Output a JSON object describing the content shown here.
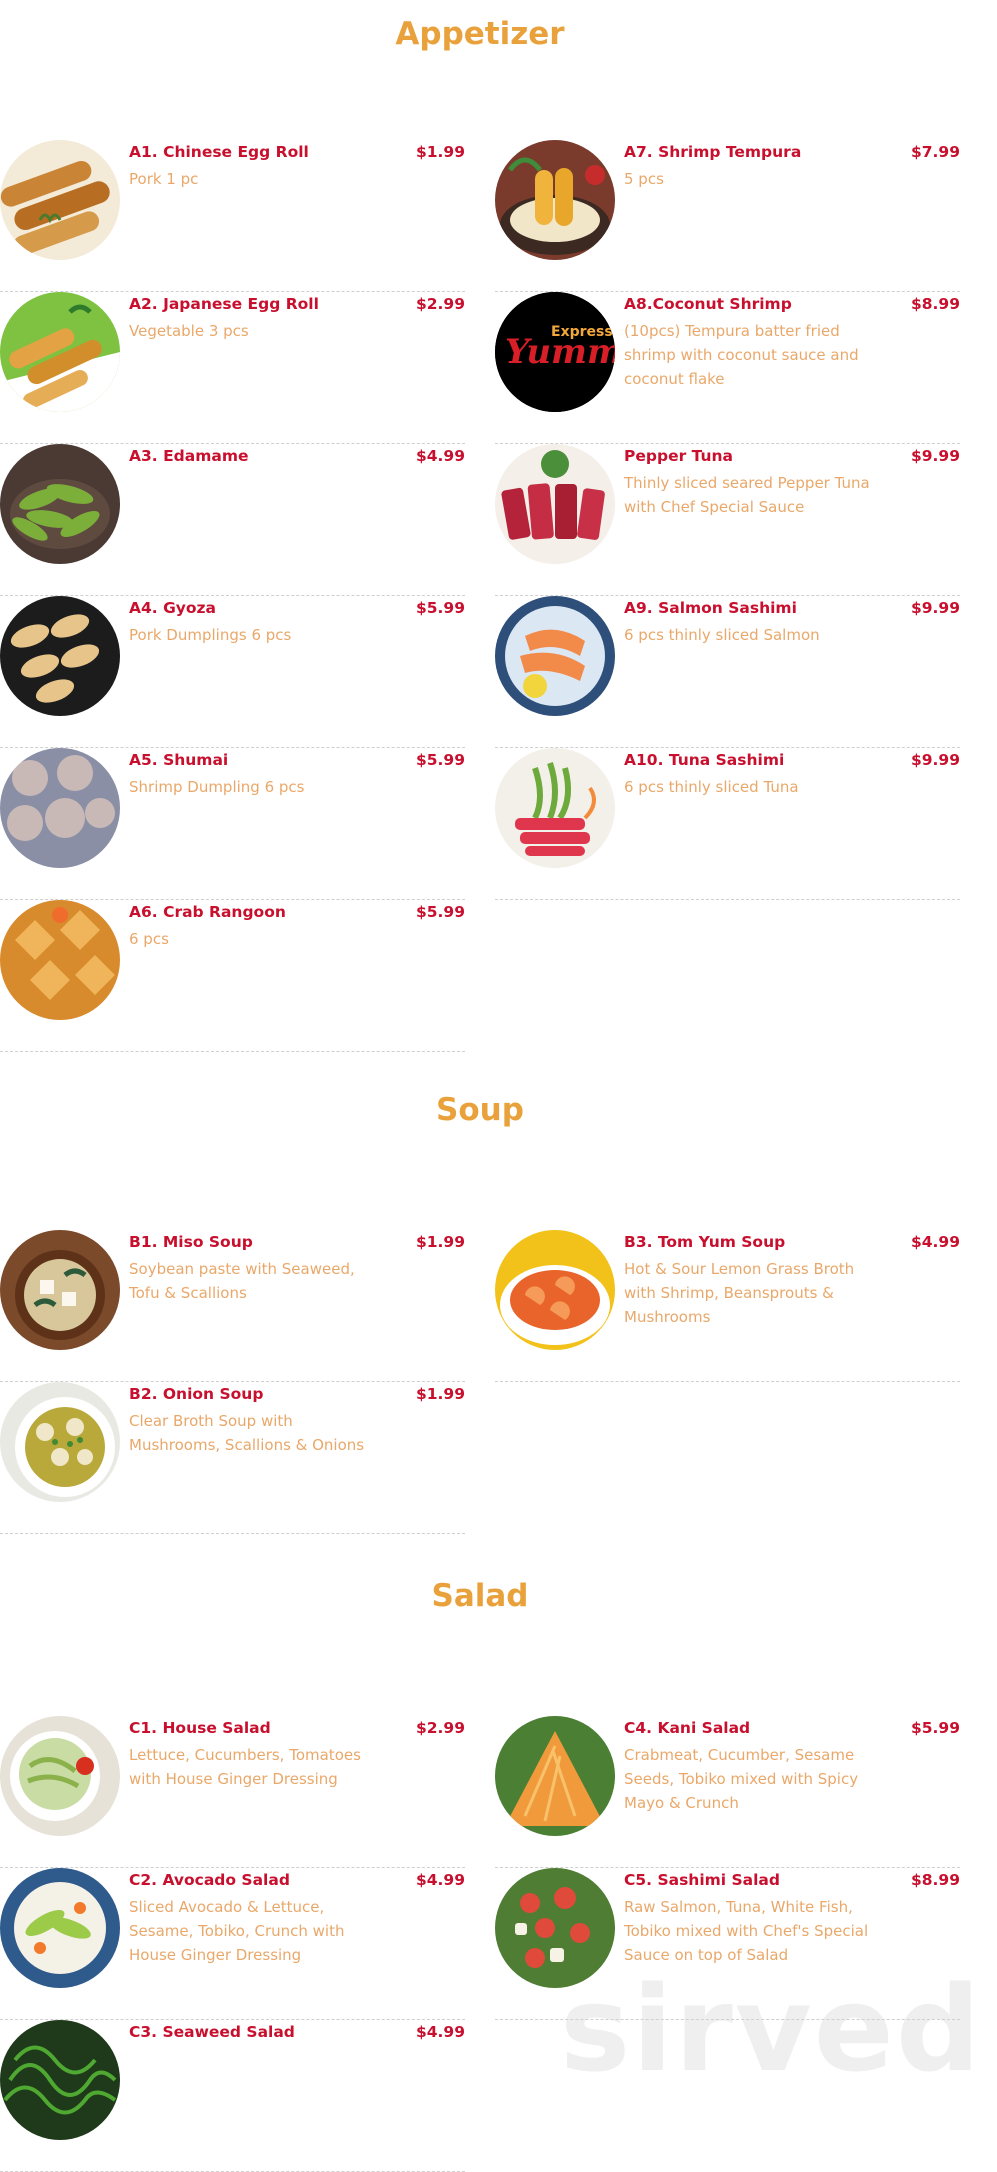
{
  "watermark": "sirved",
  "sections": {
    "appetizer": {
      "title": "Appetizer",
      "items": [
        {
          "name": "A1. Chinese Egg Roll",
          "price": "$1.99",
          "desc": "Pork 1 pc"
        },
        {
          "name": "A7. Shrimp Tempura",
          "price": "$7.99",
          "desc": "5 pcs"
        },
        {
          "name": "A2. Japanese Egg Roll",
          "price": "$2.99",
          "desc": "Vegetable 3 pcs"
        },
        {
          "name": "A8.Coconut Shrimp",
          "price": "$8.99",
          "desc": "(10pcs) Tempura batter fried shrimp with coconut sauce and coconut flake",
          "logo": {
            "top": "Express",
            "script": "Yummy"
          }
        },
        {
          "name": "A3. Edamame",
          "price": "$4.99",
          "desc": ""
        },
        {
          "name": "Pepper Tuna",
          "price": "$9.99",
          "desc": "Thinly sliced seared Pepper Tuna with Chef Special Sauce"
        },
        {
          "name": "A4. Gyoza",
          "price": "$5.99",
          "desc": "Pork Dumplings 6 pcs"
        },
        {
          "name": "A9. Salmon Sashimi",
          "price": "$9.99",
          "desc": "6 pcs thinly sliced Salmon"
        },
        {
          "name": "A5. Shumai",
          "price": "$5.99",
          "desc": "Shrimp Dumpling 6 pcs"
        },
        {
          "name": "A10. Tuna Sashimi",
          "price": "$9.99",
          "desc": "6 pcs thinly sliced Tuna"
        },
        {
          "name": "A6. Crab Rangoon",
          "price": "$5.99",
          "desc": "6 pcs"
        }
      ]
    },
    "soup": {
      "title": "Soup",
      "items": [
        {
          "name": "B1. Miso Soup",
          "price": "$1.99",
          "desc": "Soybean paste with Seaweed, Tofu & Scallions"
        },
        {
          "name": "B3. Tom Yum Soup",
          "price": "$4.99",
          "desc": "Hot & Sour Lemon Grass Broth with Shrimp, Beansprouts & Mushrooms"
        },
        {
          "name": "B2. Onion Soup",
          "price": "$1.99",
          "desc": "Clear Broth Soup with Mushrooms, Scallions & Onions"
        }
      ]
    },
    "salad": {
      "title": "Salad",
      "items": [
        {
          "name": "C1. House Salad",
          "price": "$2.99",
          "desc": "Lettuce, Cucumbers, Tomatoes with House Ginger Dressing"
        },
        {
          "name": "C4. Kani Salad",
          "price": "$5.99",
          "desc": "Crabmeat, Cucumber, Sesame Seeds, Tobiko mixed with Spicy Mayo & Crunch"
        },
        {
          "name": "C2. Avocado Salad",
          "price": "$4.99",
          "desc": "Sliced Avocado & Lettuce, Sesame, Tobiko, Crunch with House Ginger Dressing"
        },
        {
          "name": "C5. Sashimi Salad",
          "price": "$8.99",
          "desc": "Raw Salmon, Tuna, White Fish, Tobiko mixed with Chef's Special Sauce on top of Salad"
        },
        {
          "name": "C3. Seaweed Salad",
          "price": "$4.99",
          "desc": ""
        }
      ]
    }
  },
  "colors": {
    "title": "#e9a23b",
    "item_name": "#c8102e",
    "price": "#c8102e",
    "description": "#e9a86a",
    "divider": "#cfcfcf"
  }
}
